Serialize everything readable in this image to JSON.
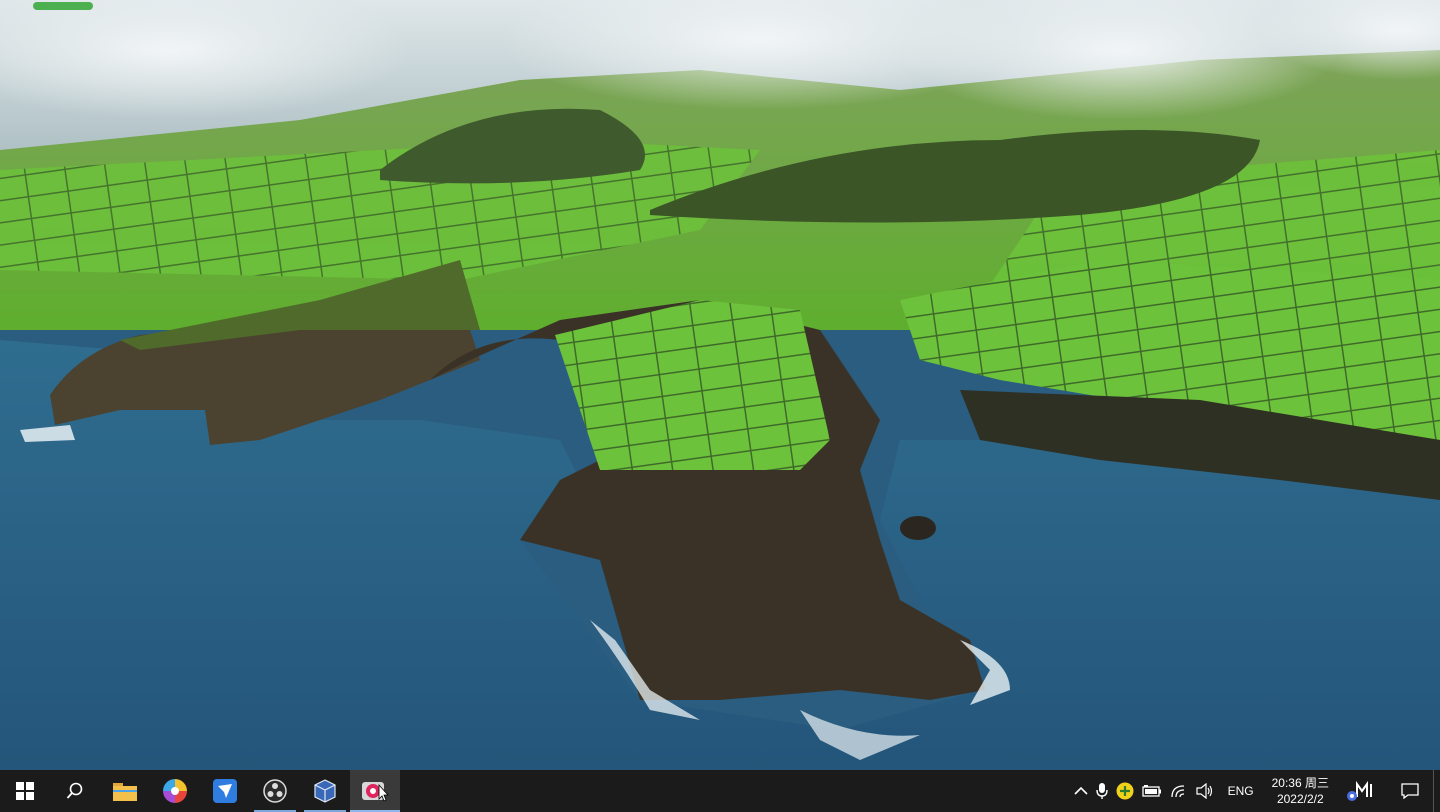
{
  "desktop": {
    "wallpaper": {
      "sea_color": "#2c6a8e",
      "field_color": "#6fbf3a",
      "cliff_color": "#3b3124",
      "cloud_color": "#e8eef0"
    },
    "top_indicator": {
      "fill_fraction": 1.0,
      "color": "#4caf50"
    }
  },
  "taskbar": {
    "background": "#1b1b1b",
    "apps": [
      {
        "icon": "windows-start-icon",
        "running": false,
        "active": false
      },
      {
        "icon": "search-icon",
        "running": false,
        "active": false
      },
      {
        "icon": "file-explorer-icon",
        "running": false,
        "active": false
      },
      {
        "icon": "color-wheel-app-icon",
        "running": false,
        "active": false
      },
      {
        "icon": "feishu-app-icon",
        "running": false,
        "active": false
      },
      {
        "icon": "obs-studio-icon",
        "running": true,
        "active": false
      },
      {
        "icon": "virtualbox-icon",
        "running": true,
        "active": false
      },
      {
        "icon": "recorder-app-icon",
        "running": true,
        "active": true
      }
    ],
    "tray": {
      "icons": [
        "chevron-up-icon",
        "microphone-icon",
        "badge-app-icon",
        "battery-icon",
        "wifi-icon",
        "speaker-icon"
      ],
      "language": "ENG",
      "time": "20:36 周三",
      "date": "2022/2/2",
      "extra_icons": [
        "meet-app-icon",
        "notification-icon"
      ]
    }
  }
}
